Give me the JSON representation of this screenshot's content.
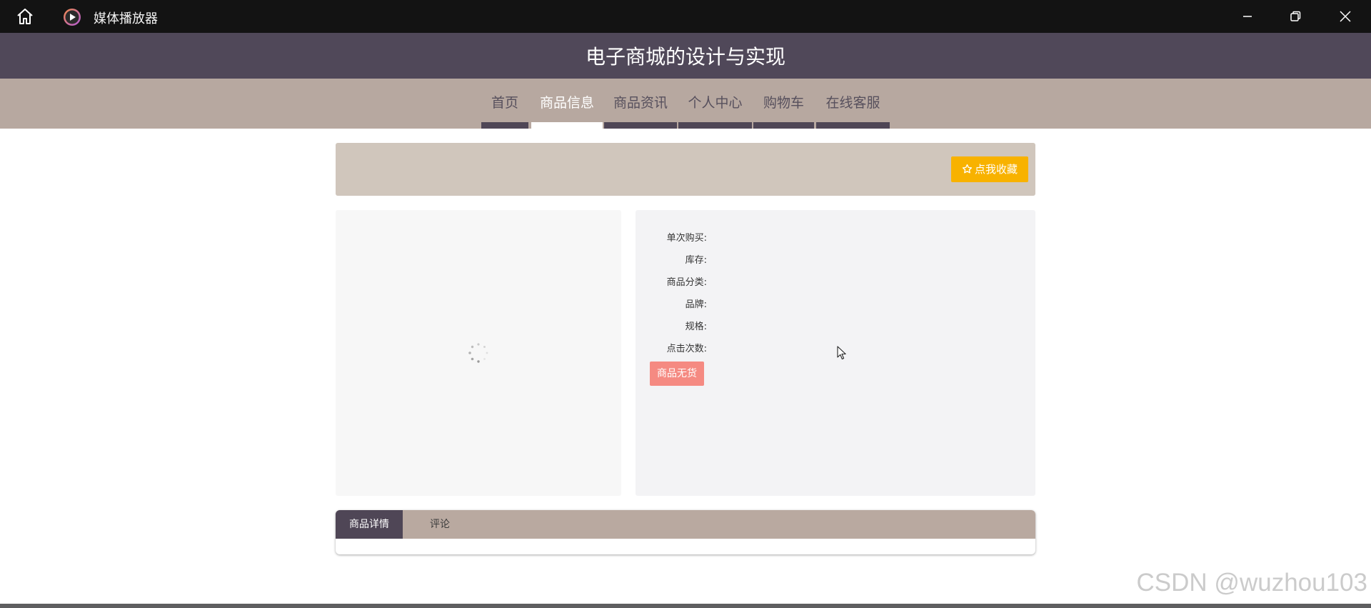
{
  "window": {
    "title": "媒体播放器"
  },
  "site": {
    "title": "电子商城的设计与实现"
  },
  "nav": {
    "items": [
      {
        "label": "首页",
        "active": false
      },
      {
        "label": "商品信息",
        "active": true
      },
      {
        "label": "商品资讯",
        "active": false
      },
      {
        "label": "个人中心",
        "active": false
      },
      {
        "label": "购物车",
        "active": false
      },
      {
        "label": "在线客服",
        "active": false
      }
    ]
  },
  "product": {
    "collect_label": "点我收藏",
    "fields": [
      {
        "label": "单次购买:",
        "value": ""
      },
      {
        "label": "库存:",
        "value": ""
      },
      {
        "label": "商品分类:",
        "value": ""
      },
      {
        "label": "品牌:",
        "value": ""
      },
      {
        "label": "规格:",
        "value": ""
      },
      {
        "label": "点击次数:",
        "value": ""
      }
    ],
    "out_of_stock_label": "商品无货"
  },
  "tabs": [
    {
      "label": "商品详情",
      "active": true
    },
    {
      "label": "评论",
      "active": false
    }
  ],
  "watermark": "CSDN @wuzhou103",
  "colors": {
    "titlebar": "#131313",
    "header": "#504859",
    "nav": "#b7a8a0",
    "collect_bar": "#d0c6bc",
    "collect_button": "#f8b200",
    "out_of_stock_button": "#f58a82"
  },
  "icons": {
    "home": "home-icon",
    "app": "media-player-icon",
    "minimize": "minimize-icon",
    "maximize": "restore-icon",
    "close": "close-icon",
    "star": "star-outline-icon",
    "loading": "loading-spinner-icon",
    "cursor": "mouse-cursor-icon"
  }
}
